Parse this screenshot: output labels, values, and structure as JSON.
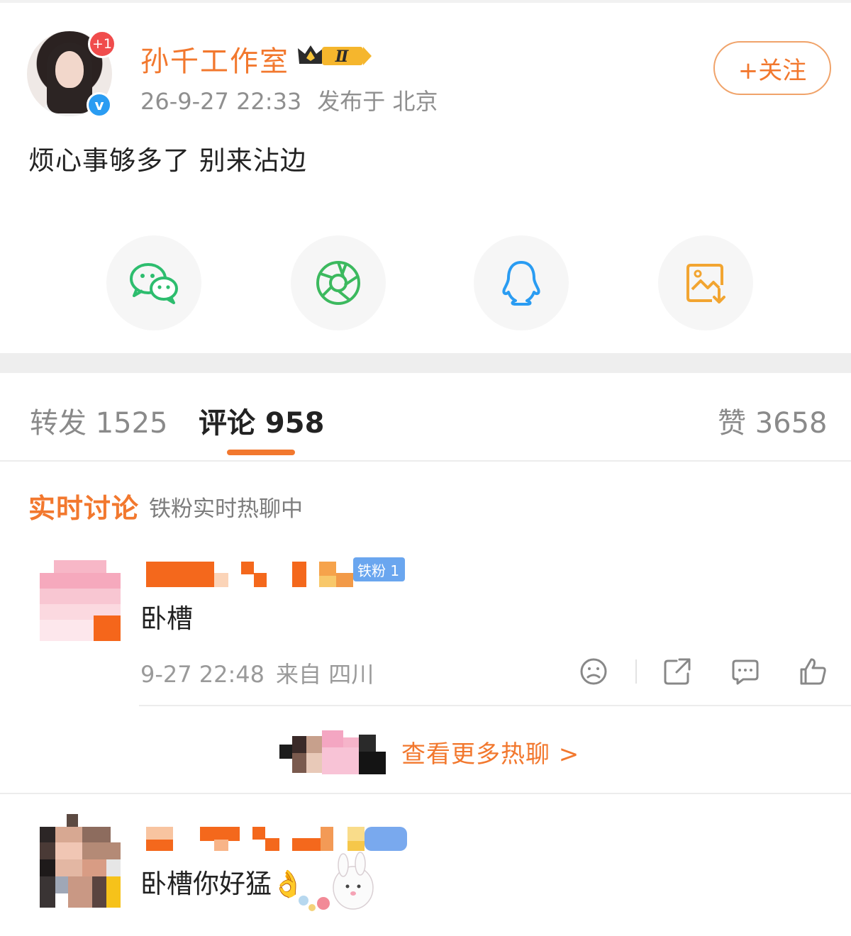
{
  "post": {
    "author": "孙千工作室",
    "level_badge": "Ⅱ",
    "avatar_notification": "+1",
    "verified_mark": "v",
    "time": "26-9-27 22:33",
    "location": "发布于 北京",
    "follow_label": "+关注",
    "text": "烦心事够多了 别来沾边"
  },
  "share": {
    "items": [
      {
        "icon": "wechat-icon",
        "color": "#2dbd6e"
      },
      {
        "icon": "moments-icon",
        "color": "#3cb95e"
      },
      {
        "icon": "qq-icon",
        "color": "#2a9cf2"
      },
      {
        "icon": "save-image-icon",
        "color": "#f2a531"
      }
    ]
  },
  "tabs": {
    "repost": "转发 1525",
    "comments": "评论 958",
    "likes": "赞 3658",
    "active": "comments"
  },
  "live": {
    "title": "实时讨论",
    "subtitle": "铁粉实时热聊中"
  },
  "comments": [
    {
      "badge": "铁粉 1",
      "text": "卧槽",
      "time": "9-27 22:48",
      "source": "来自 四川"
    },
    {
      "text": "卧槽你好猛👌"
    }
  ],
  "more_link": "查看更多热聊 >",
  "colors": {
    "accent": "#f2782e",
    "muted": "#8f8f8f",
    "badge_blue": "#6aa6ef"
  }
}
